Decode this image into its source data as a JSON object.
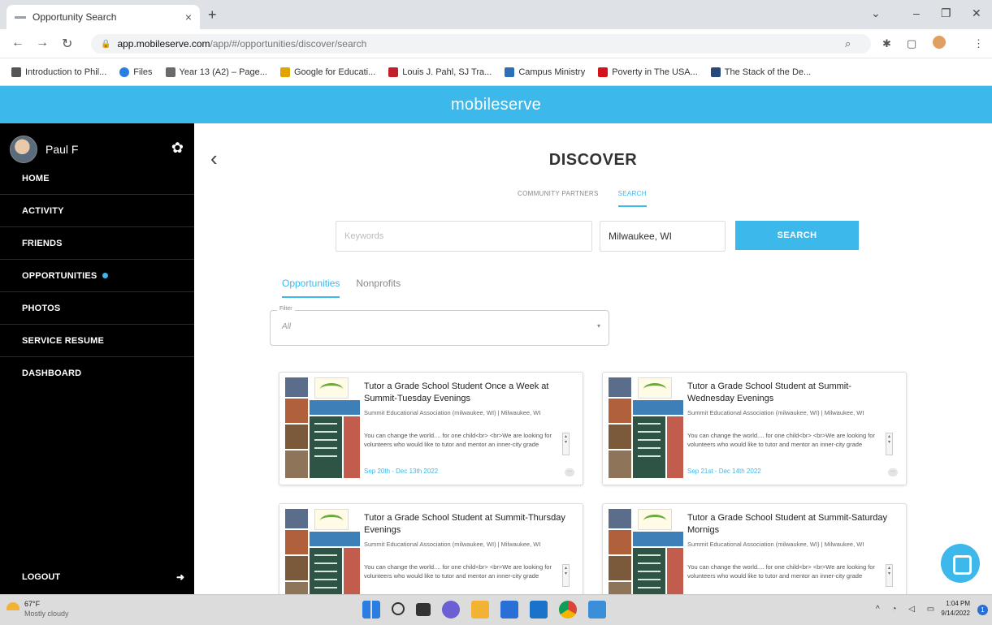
{
  "browser": {
    "tab_title": "Opportunity Search",
    "tab_close": "×",
    "new_tab": "+",
    "url_host": "app.mobileserve.com",
    "url_path": "/app/#/opportunities/discover/search",
    "bookmarks": [
      {
        "label": "Introduction to Phil...",
        "color": "#555555"
      },
      {
        "label": "Files",
        "color": "#2a7de1"
      },
      {
        "label": "Year 13 (A2) – Page...",
        "color": "#6a6a6a"
      },
      {
        "label": "Google for Educati...",
        "color": "#e0a400"
      },
      {
        "label": "Louis J. Pahl, SJ Tra...",
        "color": "#c21f2d"
      },
      {
        "label": "Campus Ministry",
        "color": "#2c6fb7"
      },
      {
        "label": "Poverty in The USA...",
        "color": "#d4121b"
      },
      {
        "label": "The Stack of the De...",
        "color": "#274a7a"
      }
    ]
  },
  "app": {
    "brand": "mobileserve",
    "accent": "#3db8ea"
  },
  "sidebar": {
    "user_name": "Paul F",
    "items": [
      {
        "label": "HOME"
      },
      {
        "label": "ACTIVITY"
      },
      {
        "label": "FRIENDS"
      },
      {
        "label": "OPPORTUNITIES"
      },
      {
        "label": "PHOTOS"
      },
      {
        "label": "SERVICE RESUME"
      },
      {
        "label": "DASHBOARD"
      }
    ],
    "logout": "LOGOUT"
  },
  "main": {
    "page_title": "DISCOVER",
    "subtabs": [
      "COMMUNITY PARTNERS",
      "SEARCH"
    ],
    "search": {
      "keywords_placeholder": "Keywords",
      "location_value": "Milwaukee, WI",
      "button": "SEARCH"
    },
    "result_tabs": [
      "Opportunities",
      "Nonprofits"
    ],
    "filter": {
      "label": "Filter",
      "value": "All"
    },
    "cards": [
      {
        "title": "Tutor a Grade School Student Once a Week at Summit-Tuesday Evenings",
        "org": "Summit Educational Association (milwaukee, WI) | Milwaukee, WI",
        "desc": "You can change the world.... for one child<br> <br>We are looking for volunteers who would like to tutor and mentor an inner-city grade",
        "date": "Sep 20th - Dec 13th 2022"
      },
      {
        "title": "Tutor a Grade School Student at Summit-Wednesday Evenings",
        "org": "Summit Educational Association (milwaukee, WI) | Milwaukee, WI",
        "desc": "You can change the world.... for one child<br> <br>We are looking for volunteers who would like to tutor and mentor an inner-city grade",
        "date": "Sep 21st - Dec 14th 2022"
      },
      {
        "title": "Tutor a Grade School Student at Summit-Thursday Evenings",
        "org": "Summit Educational Association (milwaukee, WI) | Milwaukee, WI",
        "desc": "You can change the world.... for one child<br> <br>We are looking for volunteers who would like to tutor and mentor an inner-city grade",
        "date": ""
      },
      {
        "title": "Tutor a Grade School Student at Summit-Saturday Mornigs",
        "org": "Summit Educational Association (milwaukee, WI) | Milwaukee, WI",
        "desc": "You can change the world.... for one child<br> <br>We are looking for volunteers who would like to tutor and mentor an inner-city grade",
        "date": ""
      }
    ]
  },
  "taskbar": {
    "temp": "67°F",
    "condition": "Mostly cloudy",
    "time": "1:04 PM",
    "date": "9/14/2022",
    "notifications": "1"
  }
}
